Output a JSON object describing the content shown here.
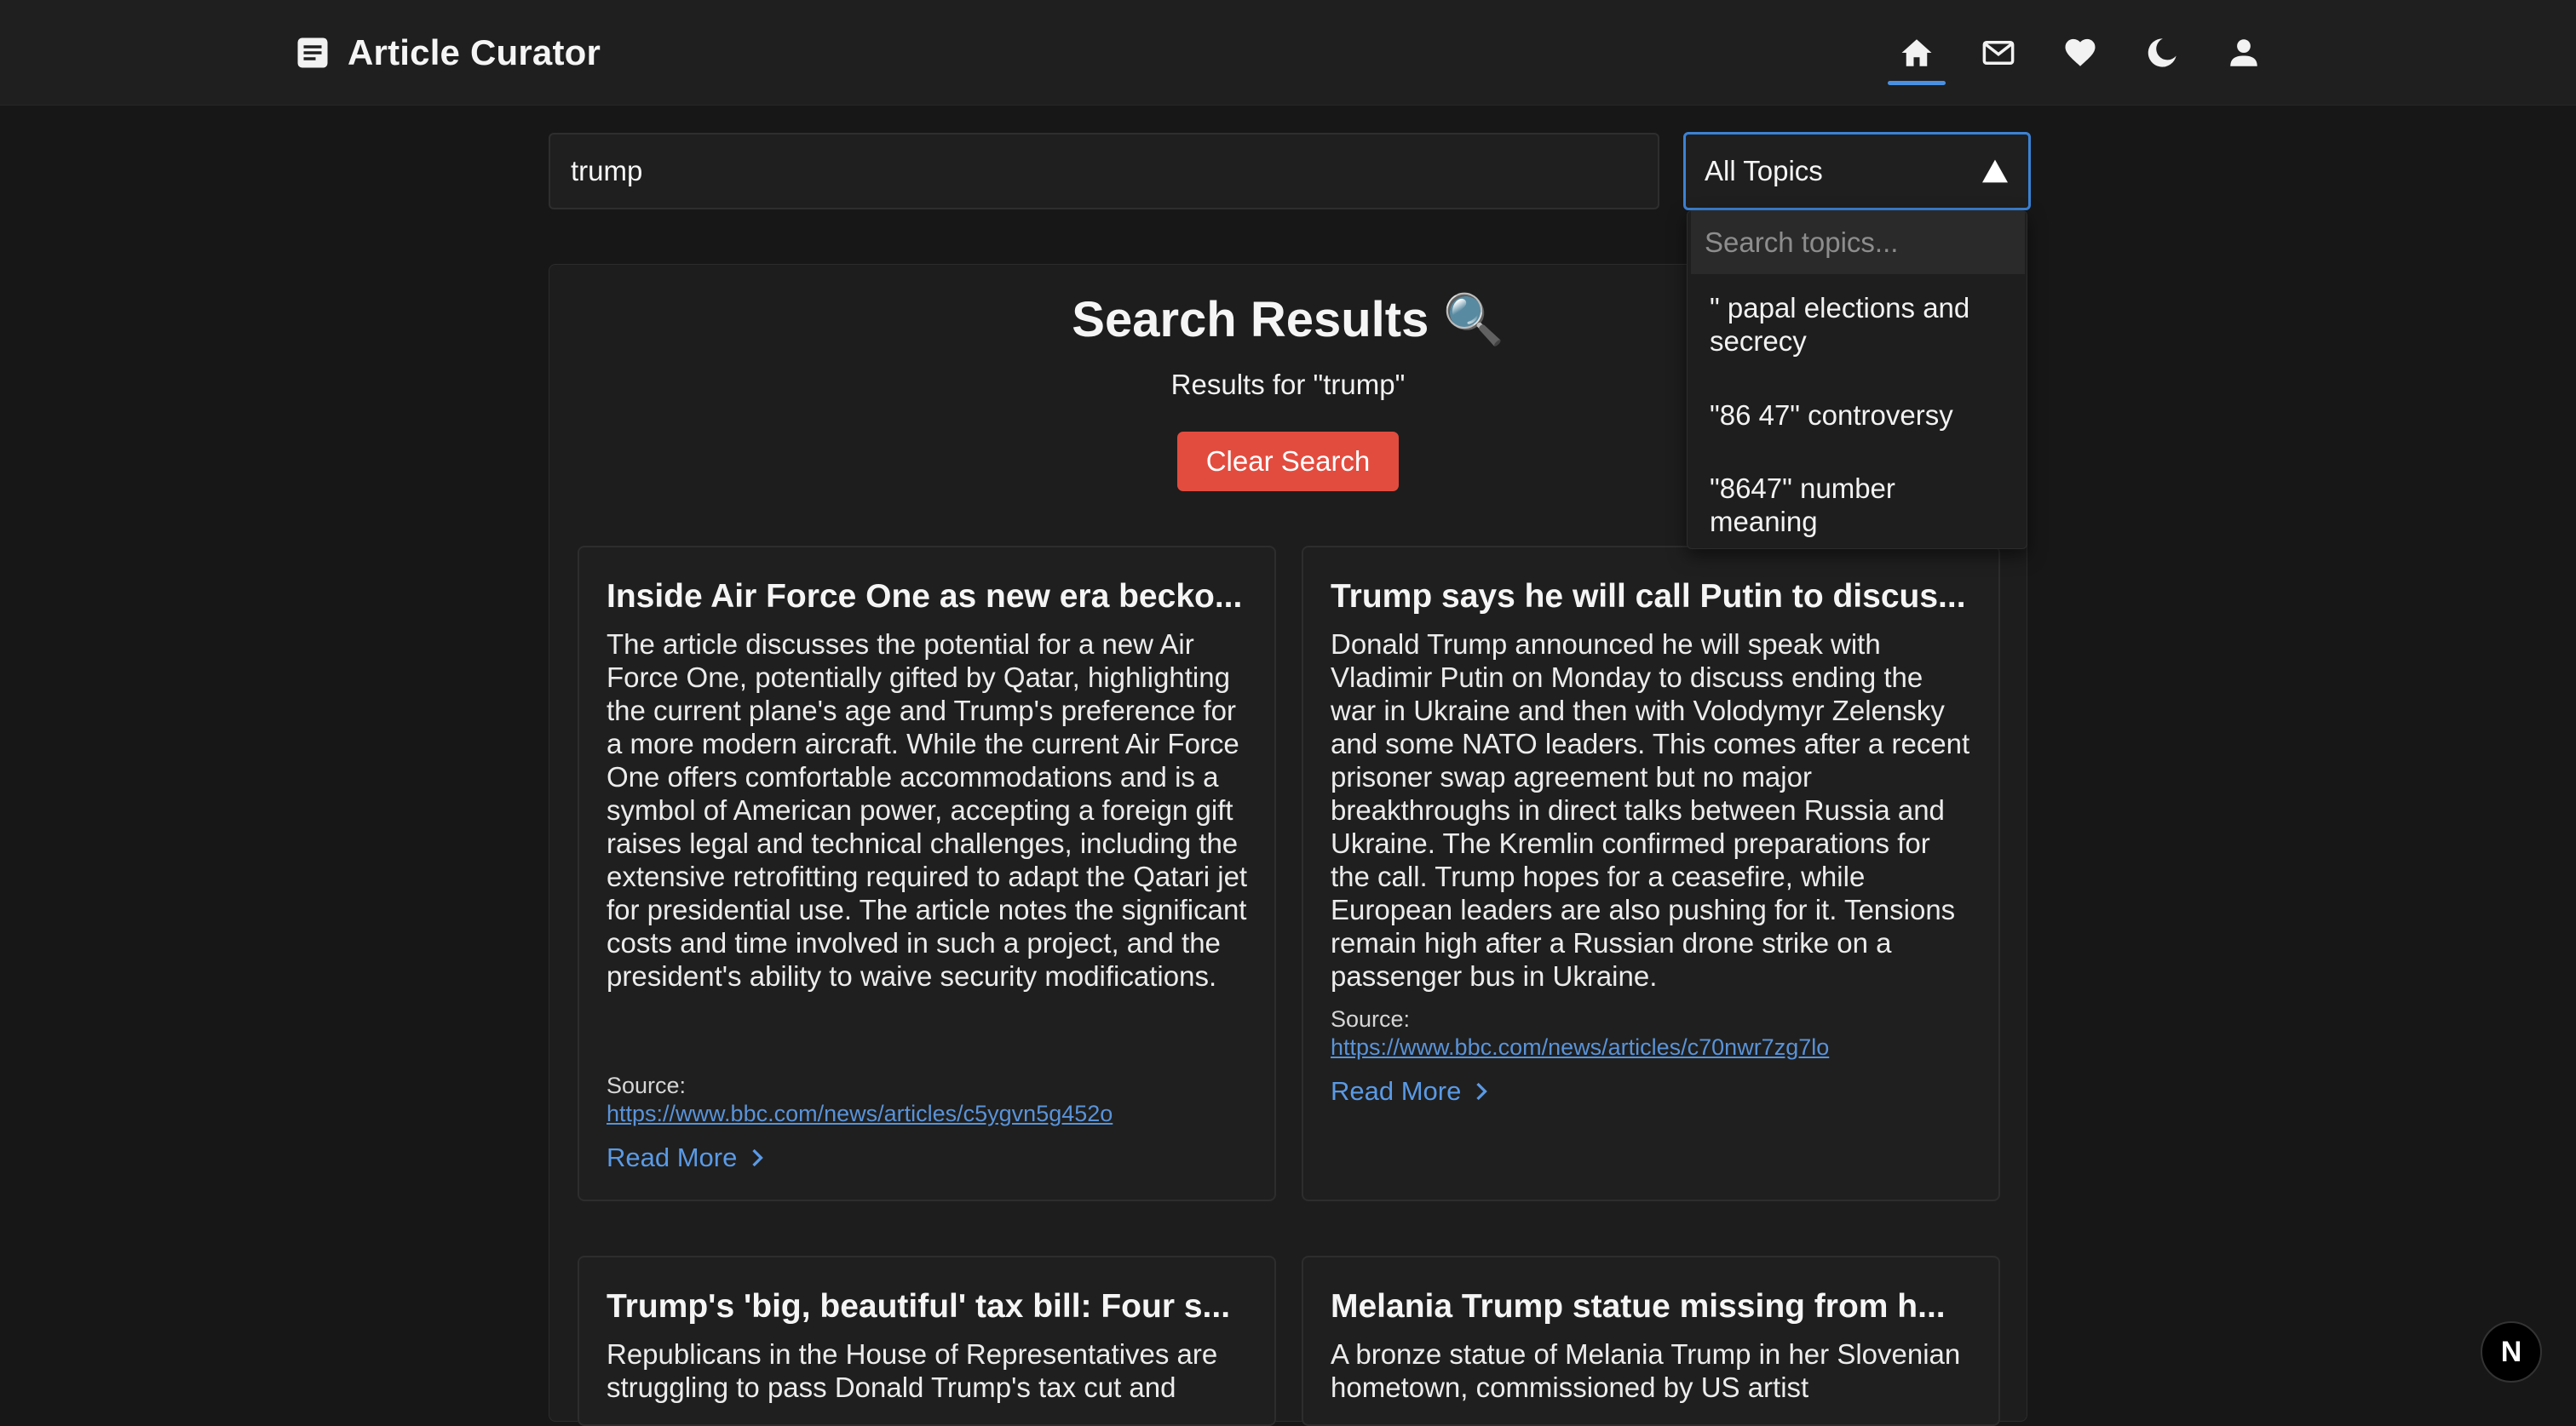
{
  "header": {
    "brand_title": "Article Curator",
    "nav": [
      {
        "icon": "home-icon",
        "active": true
      },
      {
        "icon": "mail-icon",
        "active": false
      },
      {
        "icon": "heart-icon",
        "active": false
      },
      {
        "icon": "moon-icon",
        "active": false
      },
      {
        "icon": "user-icon",
        "active": false
      }
    ],
    "accent_color": "#4a90e2"
  },
  "search": {
    "value": "trump"
  },
  "topic_filter": {
    "selected": "All Topics",
    "search_placeholder": "Search topics...",
    "options": [
      "\" papal elections and secrecy",
      "\"86 47\" controversy",
      "\"8647\" number meaning"
    ]
  },
  "results": {
    "heading": "Search Results",
    "heading_emoji": "🔍",
    "subtitle": "Results for \"trump\"",
    "clear_label": "Clear Search",
    "clear_color": "#e24c3f"
  },
  "articles": [
    {
      "title": "Inside Air Force One as new era becko...",
      "summary": "The article discusses the potential for a new Air Force One, potentially gifted by Qatar, highlighting the current plane's age and Trump's preference for a more modern aircraft. While the current Air Force One offers comfortable accommodations and is a symbol of American power, accepting a foreign gift raises legal and technical challenges, including the extensive retrofitting required to adapt the Qatari jet for presidential use. The article notes the significant costs and time involved in such a project, and the president's ability to waive security modifications.",
      "source_label": "Source:",
      "source_url": "https://www.bbc.com/news/articles/c5ygvn5g452o",
      "read_more": "Read More"
    },
    {
      "title": "Trump says he will call Putin to discus...",
      "summary": "Donald Trump announced he will speak with Vladimir Putin on Monday to discuss ending the war in Ukraine and then with Volodymyr Zelensky and some NATO leaders. This comes after a recent prisoner swap agreement but no major breakthroughs in direct talks between Russia and Ukraine. The Kremlin confirmed preparations for the call. Trump hopes for a ceasefire, while European leaders are also pushing for it. Tensions remain high after a Russian drone strike on a passenger bus in Ukraine.",
      "source_label": "Source:",
      "source_url": "https://www.bbc.com/news/articles/c70nwr7zg7lo",
      "read_more": "Read More"
    },
    {
      "title": "Trump's 'big, beautiful' tax bill: Four s...",
      "summary": "Republicans in the House of Representatives are struggling to pass Donald Trump's tax cut and"
    },
    {
      "title": "Melania Trump statue missing from h...",
      "summary": "A bronze statue of Melania Trump in her Slovenian hometown, commissioned by US artist"
    }
  ],
  "dev_badge": "N"
}
